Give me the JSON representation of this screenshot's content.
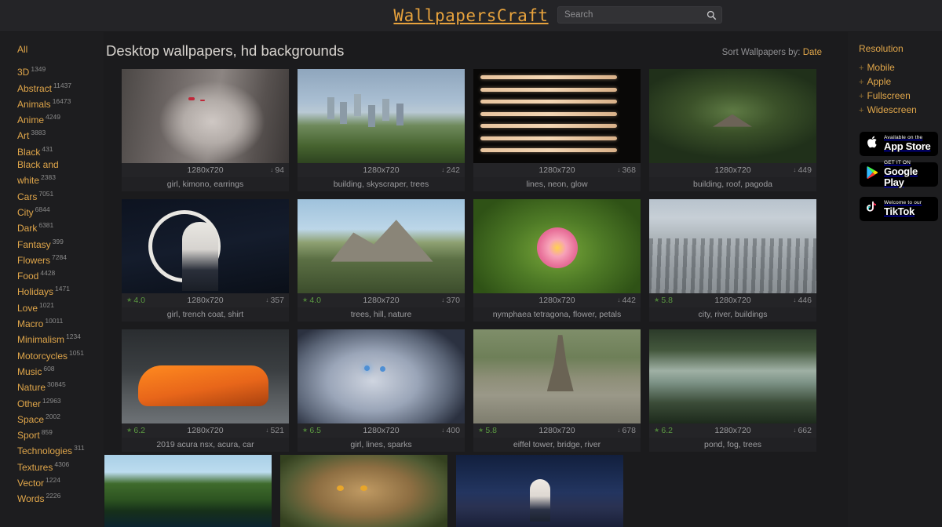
{
  "site": {
    "logo": "WallpapersCraft"
  },
  "search": {
    "placeholder": "Search",
    "value": "",
    "icon": "search-icon"
  },
  "page": {
    "title": "Desktop wallpapers, hd backgrounds",
    "sort_label": "Sort Wallpapers by:",
    "sort_value": "Date"
  },
  "colors": {
    "accent": "#e0a64a",
    "logo": "#e8a33d",
    "rating": "#5c9a42",
    "background": "#1b1b1d",
    "panel": "#1d1d1f",
    "card_meta": "#242427",
    "title_text": "#d8d4cf"
  },
  "sidebar": {
    "items": [
      {
        "label": "All",
        "count": ""
      },
      {
        "label": "3D",
        "count": "1349"
      },
      {
        "label": "Abstract",
        "count": "11437"
      },
      {
        "label": "Animals",
        "count": "16473"
      },
      {
        "label": "Anime",
        "count": "4249"
      },
      {
        "label": "Art",
        "count": "3883"
      },
      {
        "label": "Black",
        "count": "431"
      },
      {
        "label": "Black and white",
        "count": "2383"
      },
      {
        "label": "Cars",
        "count": "7051"
      },
      {
        "label": "City",
        "count": "6844"
      },
      {
        "label": "Dark",
        "count": "6381"
      },
      {
        "label": "Fantasy",
        "count": "399"
      },
      {
        "label": "Flowers",
        "count": "7284"
      },
      {
        "label": "Food",
        "count": "4428"
      },
      {
        "label": "Holidays",
        "count": "1471"
      },
      {
        "label": "Love",
        "count": "1021"
      },
      {
        "label": "Macro",
        "count": "10011"
      },
      {
        "label": "Minimalism",
        "count": "1234"
      },
      {
        "label": "Motorcycles",
        "count": "1051"
      },
      {
        "label": "Music",
        "count": "608"
      },
      {
        "label": "Nature",
        "count": "30845"
      },
      {
        "label": "Other",
        "count": "12963"
      },
      {
        "label": "Space",
        "count": "2002"
      },
      {
        "label": "Sport",
        "count": "859"
      },
      {
        "label": "Technologies",
        "count": "311"
      },
      {
        "label": "Textures",
        "count": "4306"
      },
      {
        "label": "Vector",
        "count": "1224"
      },
      {
        "label": "Words",
        "count": "2226"
      }
    ]
  },
  "resolution": {
    "title": "Resolution",
    "items": [
      {
        "label": "Mobile",
        "expand": "+"
      },
      {
        "label": "Apple",
        "expand": "+"
      },
      {
        "label": "Fullscreen",
        "expand": "+"
      },
      {
        "label": "Widescreen",
        "expand": "+"
      }
    ]
  },
  "badges": [
    {
      "name": "app-store-badge",
      "small": "Available on the",
      "big": "App Store",
      "icon": "apple-icon"
    },
    {
      "name": "google-play-badge",
      "small": "GET IT ON",
      "big": "Google Play",
      "icon": "google-play-icon"
    },
    {
      "name": "tiktok-badge",
      "small": "Welcome to our",
      "big": "TikTok",
      "icon": "tiktok-icon"
    }
  ],
  "wallpapers": [
    {
      "art": "art-anime1",
      "resolution": "1280x720",
      "rating": "",
      "downloads": "94",
      "tags": "girl, kimono, earrings"
    },
    {
      "art": "art-city1",
      "resolution": "1280x720",
      "rating": "",
      "downloads": "242",
      "tags": "building, skyscraper, trees"
    },
    {
      "art": "art-lines",
      "resolution": "1280x720",
      "rating": "",
      "downloads": "368",
      "tags": "lines, neon, glow"
    },
    {
      "art": "art-forest1",
      "resolution": "1280x720",
      "rating": "",
      "downloads": "449",
      "tags": "building, roof, pagoda"
    },
    {
      "art": "art-anime2",
      "resolution": "1280x720",
      "rating": "4.0",
      "downloads": "357",
      "tags": "girl, trench coat, shirt"
    },
    {
      "art": "art-mountain",
      "resolution": "1280x720",
      "rating": "4.0",
      "downloads": "370",
      "tags": "trees, hill, nature"
    },
    {
      "art": "art-lotus",
      "resolution": "1280x720",
      "rating": "",
      "downloads": "442",
      "tags": "nymphaea tetragona, flower, petals"
    },
    {
      "art": "art-city2",
      "resolution": "1280x720",
      "rating": "5.8",
      "downloads": "446",
      "tags": "city, river, buildings"
    },
    {
      "art": "art-car",
      "resolution": "1280x720",
      "rating": "6.2",
      "downloads": "521",
      "tags": "2019 acura nsx, acura, car"
    },
    {
      "art": "art-anime3",
      "resolution": "1280x720",
      "rating": "6.5",
      "downloads": "400",
      "tags": "girl, lines, sparks"
    },
    {
      "art": "art-eiffel",
      "resolution": "1280x720",
      "rating": "5.8",
      "downloads": "678",
      "tags": "eiffel tower, bridge, river"
    },
    {
      "art": "art-pond",
      "resolution": "1280x720",
      "rating": "6.2",
      "downloads": "662",
      "tags": "pond, fog, trees"
    }
  ],
  "bottom_row": [
    {
      "art": "art-lake"
    },
    {
      "art": "art-lynx"
    },
    {
      "art": "art-night"
    }
  ]
}
